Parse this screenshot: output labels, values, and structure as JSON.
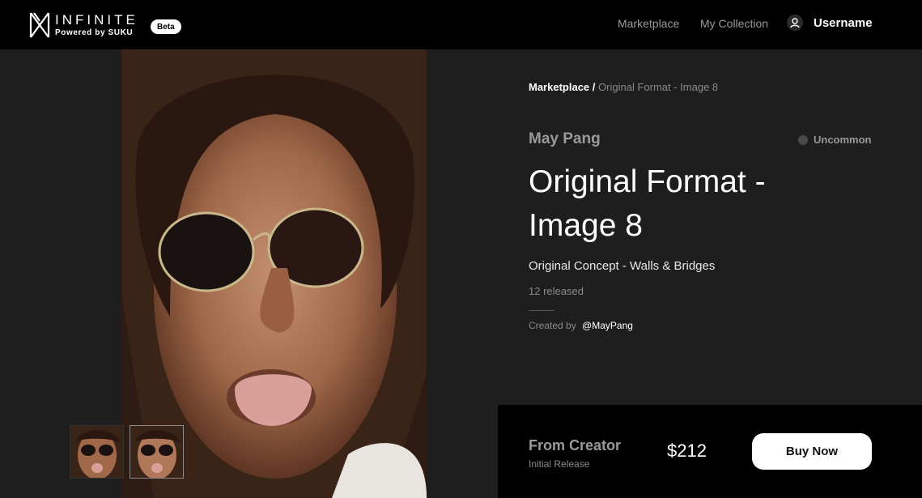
{
  "header": {
    "logo_word": "INFINITE",
    "logo_sub": "Powered by SUKU",
    "beta_label": "Beta",
    "nav": {
      "marketplace": "Marketplace",
      "my_collection": "My Collection"
    },
    "username": "Username"
  },
  "breadcrumb": {
    "root": "Marketplace",
    "separator": "/",
    "current": "Original Format - Image 8"
  },
  "item": {
    "creator_name": "May Pang",
    "rarity": "Uncommon",
    "title": "Original Format - Image 8",
    "concept": "Original Concept - Walls & Bridges",
    "released": "12 released",
    "created_by_label": "Created by",
    "created_by_handle": "@MayPang"
  },
  "purchase": {
    "source": "From Creator",
    "release_type": "Initial Release",
    "price": "$212",
    "buy_label": "Buy Now"
  },
  "colors": {
    "background": "#1e1e1e",
    "header": "#000000",
    "muted_text": "#9a9a9a",
    "button_bg": "#ffffff"
  },
  "icons": {
    "logo": "infinite-logo-icon",
    "user": "user-avatar-icon",
    "rarity": "rarity-dot-icon"
  }
}
